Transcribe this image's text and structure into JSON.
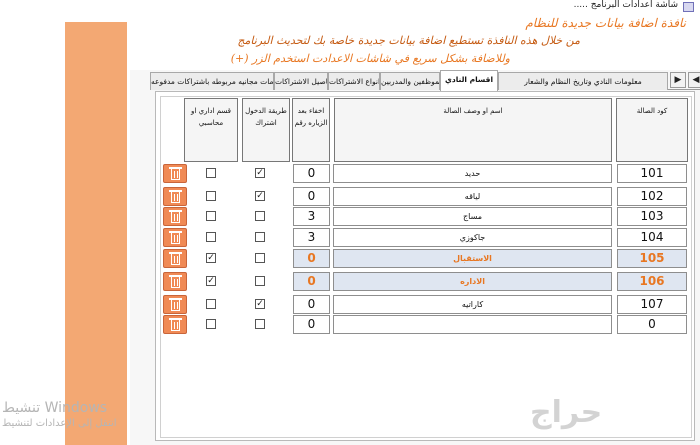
{
  "window": {
    "title": "شاشة اعدادات البرنامج ....."
  },
  "header": {
    "line1": "نافذة اضافة بيانات جديدة للنظام",
    "line2": "من خلال هذه النافذة تستطيع اضافة بيانات جديدة خاصة بك لتحديث البرنامج",
    "line3": "وللاضافة بشكل سريع في شاشات الاعدادت استخدم الزر (+)"
  },
  "tabs": [
    "معلومات النادي وتاريخ النظام والشعار",
    "اقسام النادي",
    "الموظفين والمدربين",
    "انواع الاشتراكات",
    "تفاصيل الاشتراكات",
    "خدمات مجانيه مربوطه باشتراكات مدفوعه"
  ],
  "active_tab": "اقسام النادي",
  "nav": {
    "prev": "◀",
    "next": "▶"
  },
  "table": {
    "headers": {
      "code": "كود الصالة",
      "name": "اسم او وصف الصالة",
      "after_visit": "اخفاء بعد الزياره رقم",
      "entry_method": "طريقة الدخول اشتراك",
      "admin_section": "قسم اداري او محاسبي"
    },
    "rows": [
      {
        "code": "101",
        "name": "حديد",
        "after": "0",
        "entry": true,
        "admin": false
      },
      {
        "code": "102",
        "name": "لياقه",
        "after": "0",
        "entry": true,
        "admin": false
      },
      {
        "code": "103",
        "name": "مساج",
        "after": "3",
        "entry": false,
        "admin": false
      },
      {
        "code": "104",
        "name": "جاكوزي",
        "after": "3",
        "entry": false,
        "admin": false
      },
      {
        "code": "105",
        "name": "الاستقبال",
        "after": "0",
        "entry": false,
        "admin": true,
        "highlight": true
      },
      {
        "code": "106",
        "name": "الاداره",
        "after": "0",
        "entry": false,
        "admin": true,
        "highlight": true
      },
      {
        "code": "107",
        "name": "كاراتيه",
        "after": "0",
        "entry": true,
        "admin": false
      },
      {
        "code": "0",
        "name": "",
        "after": "0",
        "entry": false,
        "admin": false
      }
    ]
  },
  "watermark": {
    "windows_line1": "تنشيط Windows",
    "windows_line2": "انتقل إلى الإعدادات لتنشيط",
    "site_logo": "حراج"
  },
  "colors": {
    "accent": "#e87722",
    "strip": "#f3a873",
    "delete_button": "#f08a55",
    "highlight_row": "#dfe6f1"
  },
  "icons": {
    "delete": "trash-icon",
    "check": "check-icon"
  }
}
